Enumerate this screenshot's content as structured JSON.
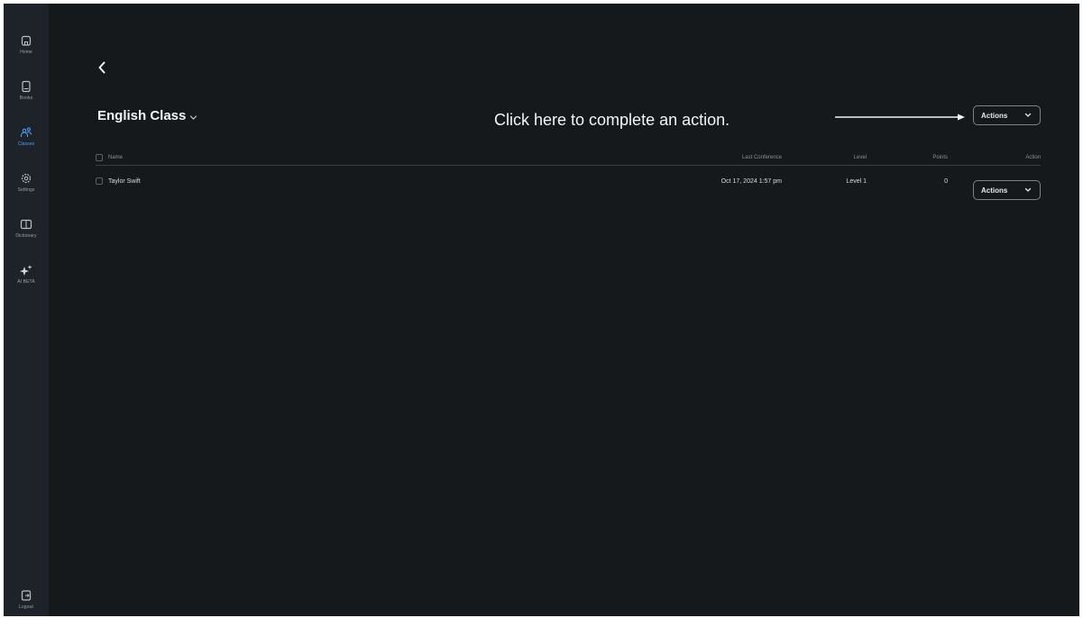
{
  "sidebar": {
    "items": [
      {
        "label": "Home",
        "icon": "home-icon"
      },
      {
        "label": "Books",
        "icon": "book-icon"
      },
      {
        "label": "Classes",
        "icon": "classes-icon",
        "active": true
      },
      {
        "label": "Settings",
        "icon": "gear-icon"
      },
      {
        "label": "Dictionary",
        "icon": "dictionary-icon"
      },
      {
        "label": "AI BETA",
        "icon": "sparkle-icon"
      }
    ],
    "logout_label": "Logout"
  },
  "page": {
    "title": "English Class",
    "hint": "Click here to complete an action.",
    "actions_label": "Actions"
  },
  "table": {
    "columns": [
      "Name",
      "Last Conference",
      "Level",
      "Points",
      "Action"
    ],
    "rows": [
      {
        "name": "Taylor Swift",
        "last_conference": "Oct 17, 2024 1:57 pm",
        "level": "Level 1",
        "points": "0",
        "action": "Actions"
      }
    ]
  },
  "colors": {
    "background": "#16191c",
    "sidebar": "#1e2329",
    "accent": "#4aa3ff"
  }
}
